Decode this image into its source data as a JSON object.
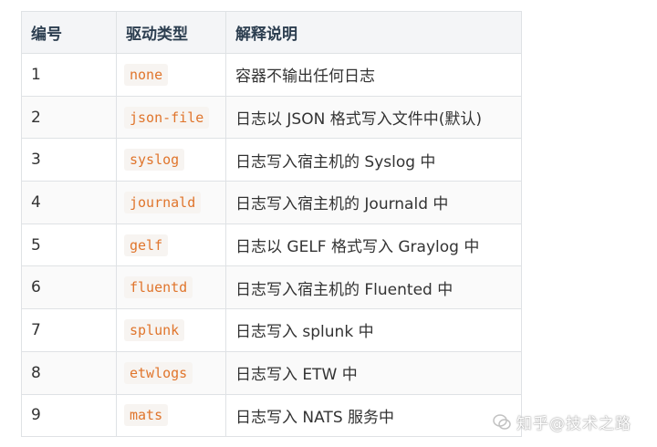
{
  "table": {
    "headers": [
      "编号",
      "驱动类型",
      "解释说明"
    ],
    "rows": [
      {
        "num": "1",
        "driver": "none",
        "desc": "容器不输出任何日志"
      },
      {
        "num": "2",
        "driver": "json-file",
        "desc": "日志以 JSON 格式写入文件中(默认)"
      },
      {
        "num": "3",
        "driver": "syslog",
        "desc": "日志写入宿主机的 Syslog 中"
      },
      {
        "num": "4",
        "driver": "journald",
        "desc": "日志写入宿主机的 Journald 中"
      },
      {
        "num": "5",
        "driver": "gelf",
        "desc": "日志以 GELF 格式写入 Graylog 中"
      },
      {
        "num": "6",
        "driver": "fluentd",
        "desc": "日志写入宿主机的 Fluented 中"
      },
      {
        "num": "7",
        "driver": "splunk",
        "desc": "日志写入 splunk 中"
      },
      {
        "num": "8",
        "driver": "etwlogs",
        "desc": "日志写入 ETW 中"
      },
      {
        "num": "9",
        "driver": "mats",
        "desc": "日志写入 NATS 服务中"
      }
    ]
  },
  "watermark": {
    "text": "知乎@技术之路",
    "icon": "wechat-icon"
  },
  "colors": {
    "code_text": "#e0752c",
    "header_bg": "#f4f5f7",
    "border": "#dfe2e5"
  }
}
